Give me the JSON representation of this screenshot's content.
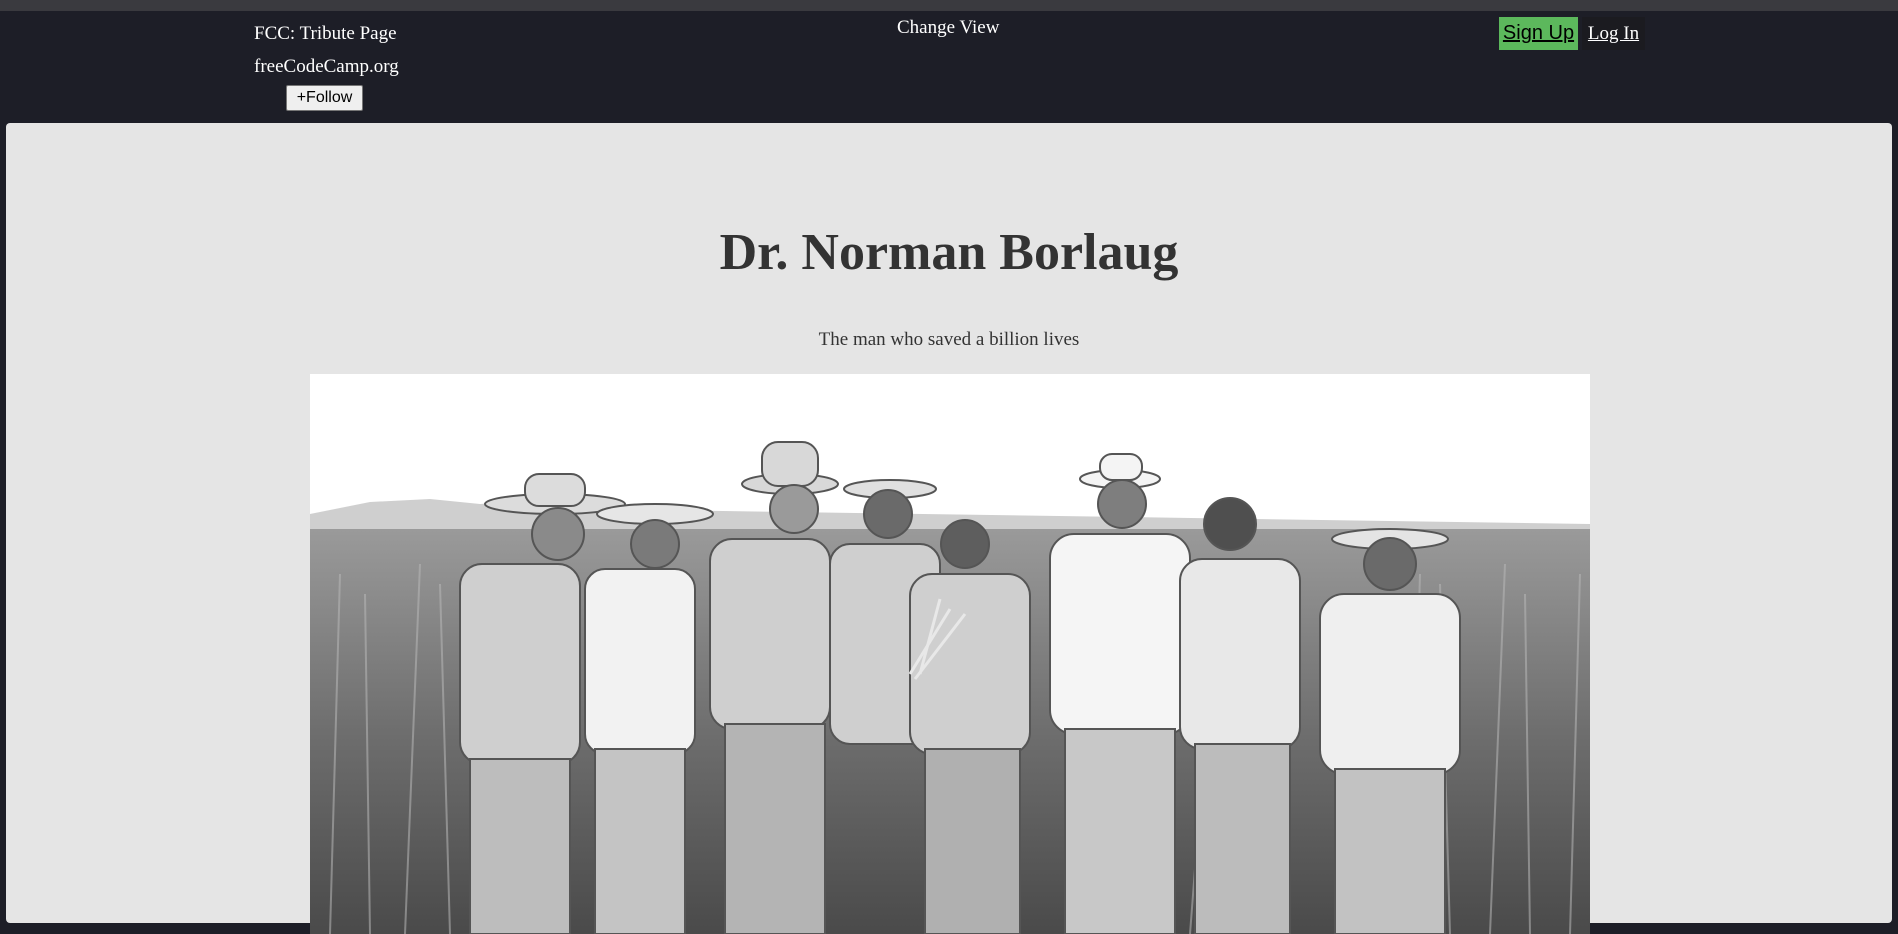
{
  "header": {
    "title": "FCC: Tribute Page",
    "org": "freeCodeCamp.org",
    "follow_label": "+Follow",
    "change_view_label": "Change View",
    "signup_label": "Sign Up",
    "login_label": "Log In"
  },
  "main": {
    "title": "Dr. Norman Borlaug",
    "subtitle": "The man who saved a billion lives"
  },
  "colors": {
    "header_bg": "#1d1e27",
    "main_bg": "#e5e5e5",
    "signup_bg": "#5cb85c",
    "text_dark": "#333333"
  }
}
